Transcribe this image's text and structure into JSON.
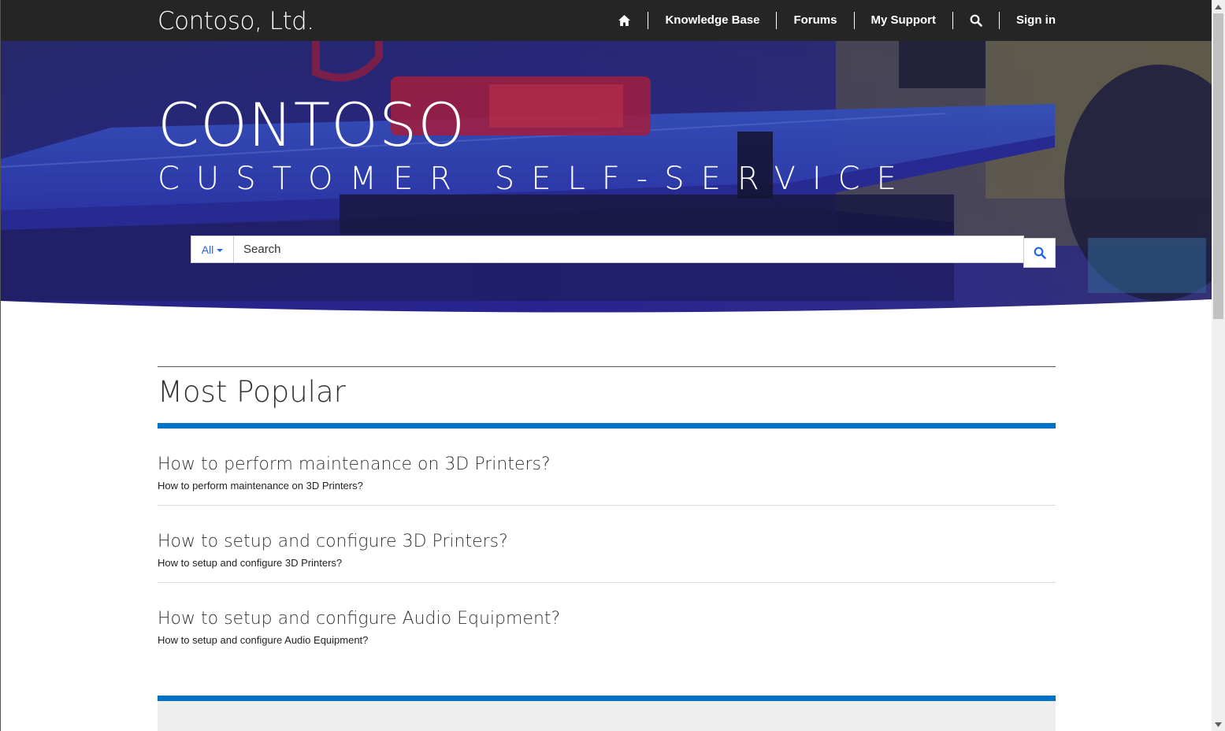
{
  "header": {
    "brand": "Contoso, Ltd.",
    "nav": [
      {
        "label": "Knowledge Base"
      },
      {
        "label": "Forums"
      },
      {
        "label": "My Support"
      }
    ],
    "sign_in": "Sign in",
    "home_icon": "home-icon",
    "search_icon": "search-icon"
  },
  "hero": {
    "title": "CONTOSO",
    "subtitle": "CUSTOMER SELF-SERVICE",
    "search": {
      "scope": "All",
      "placeholder": "Search"
    }
  },
  "main": {
    "section_title": "Most Popular",
    "articles": [
      {
        "title": "How to perform maintenance on 3D Printers?",
        "description": "How to perform maintenance on 3D Printers?"
      },
      {
        "title": "How to setup and configure 3D Printers?",
        "description": "How to setup and configure 3D Printers?"
      },
      {
        "title": "How to setup and configure Audio Equipment?",
        "description": "How to setup and configure Audio Equipment?"
      }
    ]
  },
  "colors": {
    "nav_bg": "#252525",
    "accent": "#0072c6",
    "link": "#2266e3",
    "hero_tint": "#2a2aa8"
  }
}
